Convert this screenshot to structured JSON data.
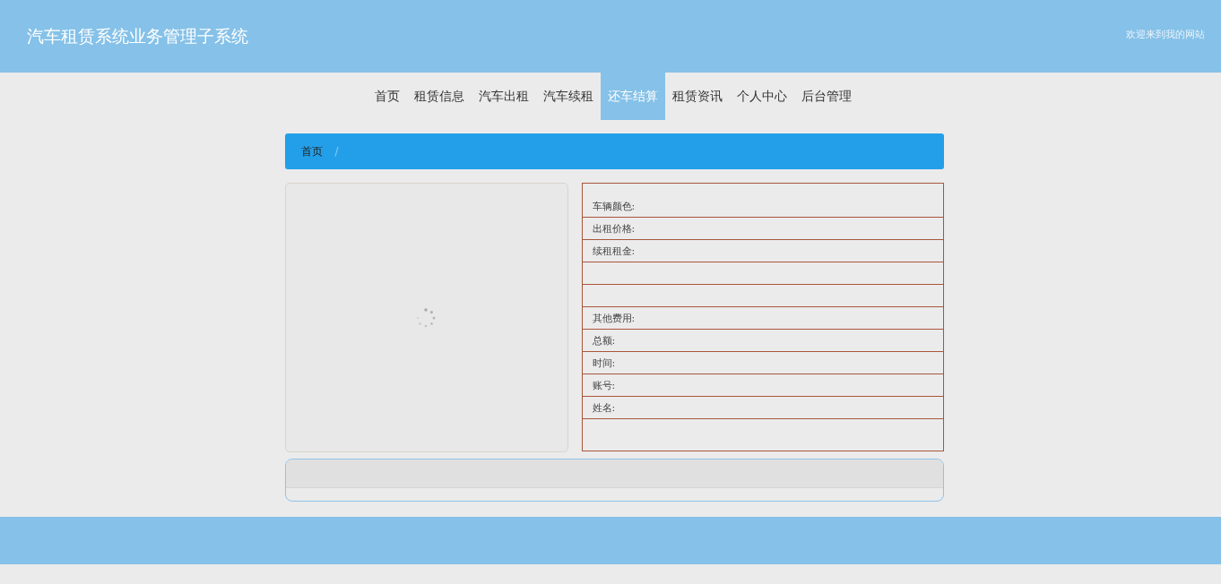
{
  "header": {
    "title": "汽车租赁系统业务管理子系统",
    "welcome": "欢迎来到我的网站"
  },
  "nav": [
    {
      "label": "首页",
      "selected": false
    },
    {
      "label": "租赁信息",
      "selected": false
    },
    {
      "label": "汽车出租",
      "selected": false
    },
    {
      "label": "汽车续租",
      "selected": false
    },
    {
      "label": "还车结算",
      "selected": true
    },
    {
      "label": "租赁资讯",
      "selected": false
    },
    {
      "label": "个人中心",
      "selected": false
    },
    {
      "label": "后台管理",
      "selected": false
    }
  ],
  "breadcrumb": {
    "items": [
      "首页"
    ],
    "separator": "/"
  },
  "details": [
    {
      "kind": "field",
      "label": "车辆颜色:"
    },
    {
      "kind": "field",
      "label": "出租价格:"
    },
    {
      "kind": "field",
      "label": "续租租金:"
    },
    {
      "kind": "blank"
    },
    {
      "kind": "blank"
    },
    {
      "kind": "field",
      "label": "其他费用:"
    },
    {
      "kind": "field",
      "label": "总额:"
    },
    {
      "kind": "field",
      "label": "时间:"
    },
    {
      "kind": "field",
      "label": "账号:"
    },
    {
      "kind": "field",
      "label": "姓名:"
    }
  ]
}
